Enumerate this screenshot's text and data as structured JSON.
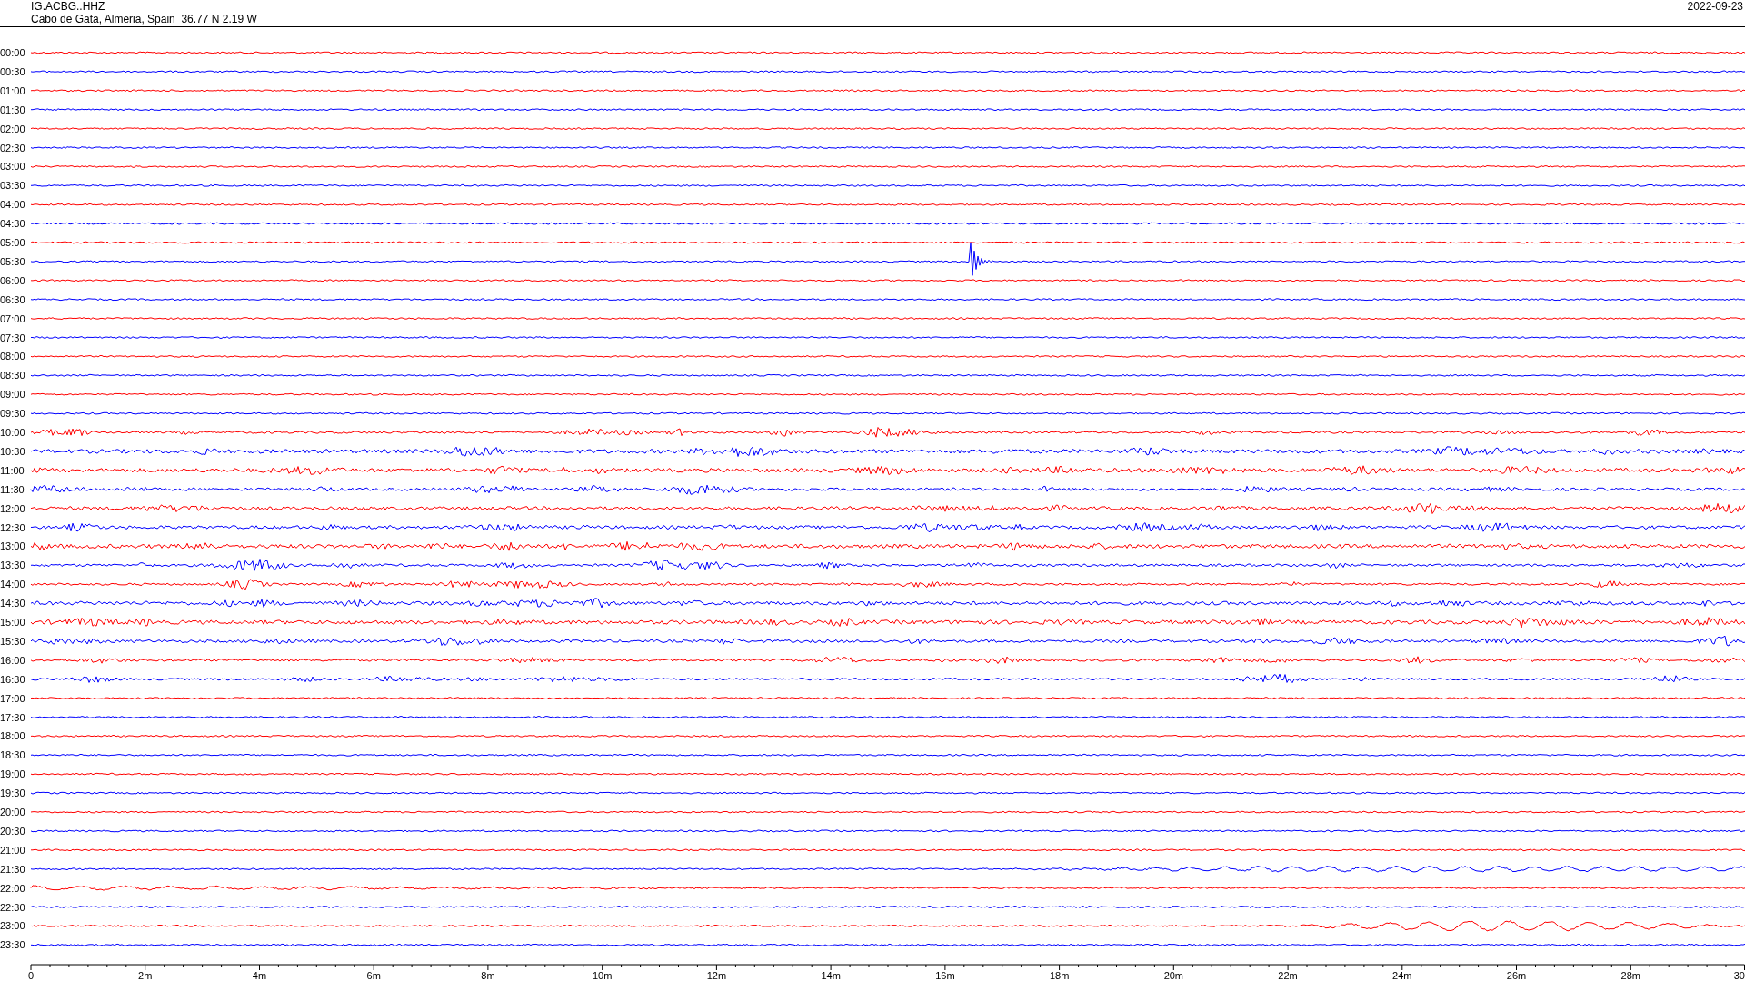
{
  "header": {
    "station": "IG.ACBG..HHZ",
    "location": "Cabo de Gata, Almeria, Spain  36.77 N 2.19 W",
    "date": "2022-09-23"
  },
  "traces": [
    {
      "label": "00:00",
      "color": "#ff0000"
    },
    {
      "label": "00:30",
      "color": "#0000ff"
    },
    {
      "label": "01:00",
      "color": "#ff0000"
    },
    {
      "label": "01:30",
      "color": "#0000ff"
    },
    {
      "label": "02:00",
      "color": "#ff0000"
    },
    {
      "label": "02:30",
      "color": "#0000ff"
    },
    {
      "label": "03:00",
      "color": "#ff0000"
    },
    {
      "label": "03:30",
      "color": "#0000ff"
    },
    {
      "label": "04:00",
      "color": "#ff0000"
    },
    {
      "label": "04:30",
      "color": "#0000ff"
    },
    {
      "label": "05:00",
      "color": "#ff0000"
    },
    {
      "label": "05:30",
      "color": "#0000ff"
    },
    {
      "label": "06:00",
      "color": "#ff0000"
    },
    {
      "label": "06:30",
      "color": "#0000ff"
    },
    {
      "label": "07:00",
      "color": "#ff0000"
    },
    {
      "label": "07:30",
      "color": "#0000ff"
    },
    {
      "label": "08:00",
      "color": "#ff0000"
    },
    {
      "label": "08:30",
      "color": "#0000ff"
    },
    {
      "label": "09:00",
      "color": "#ff0000"
    },
    {
      "label": "09:30",
      "color": "#0000ff"
    },
    {
      "label": "10:00",
      "color": "#ff0000"
    },
    {
      "label": "10:30",
      "color": "#0000ff"
    },
    {
      "label": "11:00",
      "color": "#ff0000"
    },
    {
      "label": "11:30",
      "color": "#0000ff"
    },
    {
      "label": "12:00",
      "color": "#ff0000"
    },
    {
      "label": "12:30",
      "color": "#0000ff"
    },
    {
      "label": "13:00",
      "color": "#ff0000"
    },
    {
      "label": "13:30",
      "color": "#0000ff"
    },
    {
      "label": "14:00",
      "color": "#ff0000"
    },
    {
      "label": "14:30",
      "color": "#0000ff"
    },
    {
      "label": "15:00",
      "color": "#ff0000"
    },
    {
      "label": "15:30",
      "color": "#0000ff"
    },
    {
      "label": "16:00",
      "color": "#ff0000"
    },
    {
      "label": "16:30",
      "color": "#0000ff"
    },
    {
      "label": "17:00",
      "color": "#ff0000"
    },
    {
      "label": "17:30",
      "color": "#0000ff"
    },
    {
      "label": "18:00",
      "color": "#ff0000"
    },
    {
      "label": "18:30",
      "color": "#0000ff"
    },
    {
      "label": "19:00",
      "color": "#ff0000"
    },
    {
      "label": "19:30",
      "color": "#0000ff"
    },
    {
      "label": "20:00",
      "color": "#ff0000"
    },
    {
      "label": "20:30",
      "color": "#0000ff"
    },
    {
      "label": "21:00",
      "color": "#ff0000"
    },
    {
      "label": "21:30",
      "color": "#0000ff"
    },
    {
      "label": "22:00",
      "color": "#ff0000"
    },
    {
      "label": "22:30",
      "color": "#0000ff"
    },
    {
      "label": "23:00",
      "color": "#ff0000"
    },
    {
      "label": "23:30",
      "color": "#0000ff"
    }
  ],
  "time_axis": {
    "labels": [
      "0",
      "2m",
      "4m",
      "6m",
      "8m",
      "10m",
      "12m",
      "14m",
      "16m",
      "18m",
      "20m",
      "22m",
      "24m",
      "26m",
      "28m",
      "30"
    ]
  }
}
